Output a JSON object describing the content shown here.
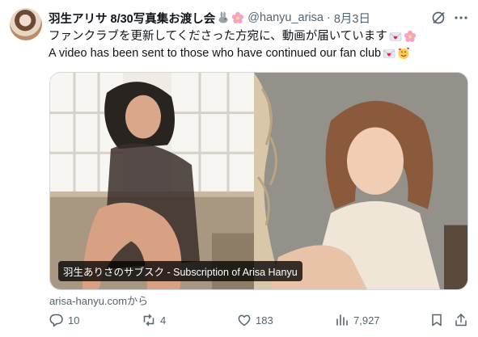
{
  "post": {
    "author_name": "羽生アリサ 8/30写真集お渡し会",
    "handle": "@hanyu_arisa",
    "separator": "·",
    "date": "8月3日",
    "text_line1": "ファンクラブを更新してくださった方宛に、動画が届いています",
    "text_line2": "A video has been sent to those who have continued our fan club",
    "card_title": "羽生ありさのサブスク - Subscription of Arisa Hanyu",
    "card_source": "arisa-hanyu.comから",
    "stats": {
      "replies": "10",
      "reposts": "4",
      "likes": "183",
      "views": "7,927"
    },
    "icons": [
      "grok-icon",
      "more-icon",
      "reply-icon",
      "repost-icon",
      "like-icon",
      "views-icon",
      "bookmark-icon",
      "share-icon"
    ],
    "accent_color": "#536471"
  }
}
